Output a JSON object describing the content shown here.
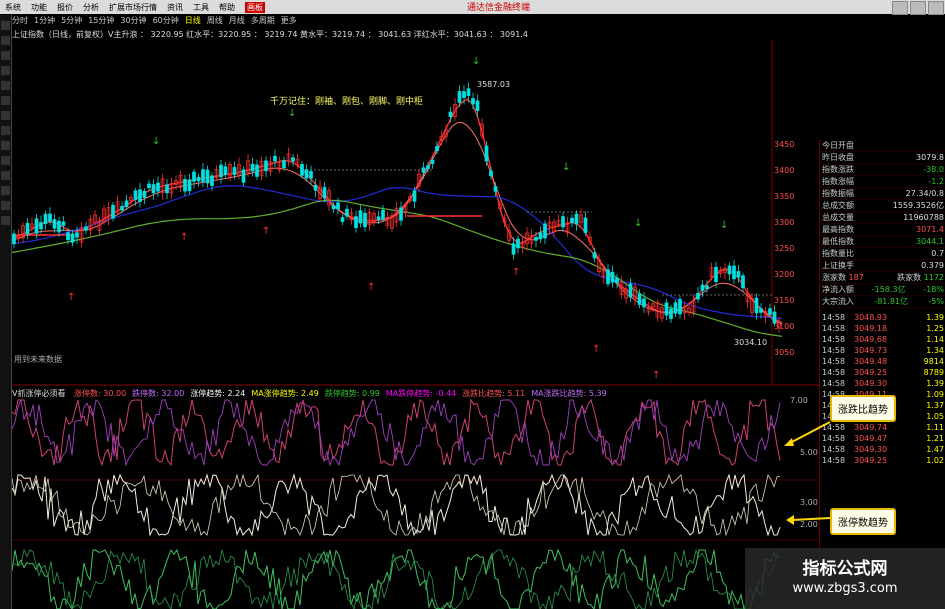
{
  "menubar": {
    "items": [
      "系统",
      "功能",
      "报价",
      "分析",
      "扩展市场行情",
      "资讯",
      "工具",
      "帮助"
    ],
    "active_item": "画板",
    "brand": "通达信金融终端"
  },
  "periods": {
    "items": [
      "分时",
      "1分钟",
      "5分钟",
      "15分钟",
      "30分钟",
      "60分钟",
      "日线",
      "周线",
      "月线",
      "多周期",
      "更多"
    ],
    "active": "日线"
  },
  "info_line": "上证指数（日线，前复权）V主升浪 ： 3220.95 红水平：3220.95 ： 3219.74 黄水平：3219.74 ： 3041.63 洋红水平：3041.63 ： 3091.4",
  "main_chart": {
    "annotation": "千万记住：刚袖、刚包、刚脚、刚中柜",
    "high_label": "3587.03",
    "low_label": "3034.10",
    "axis_ticks": [
      "3450",
      "3400",
      "3350",
      "3300",
      "3250",
      "3200",
      "3150",
      "3100",
      "3050"
    ],
    "past_label": "用到未来数据"
  },
  "indicator1": {
    "title": "V抓涨停必须看",
    "items": [
      {
        "label": "涨停数:",
        "value": "30.00",
        "color": "#ff5050"
      },
      {
        "label": "跌停数:",
        "value": "32.00",
        "color": "#c06cff"
      },
      {
        "label": "涨停趋势:",
        "value": "2.24",
        "color": "#ffffff"
      },
      {
        "label": "MA涨停趋势:",
        "value": "2.49",
        "color": "#ffff00"
      },
      {
        "label": "跌停趋势:",
        "value": "0.99",
        "color": "#2ec72e"
      },
      {
        "label": "MA跌停趋势:",
        "value": "-0.44",
        "color": "#ff00ff"
      },
      {
        "label": "涨跌比趋势:",
        "value": "5.11",
        "color": "#ff5050"
      },
      {
        "label": "MA涨跌比趋势:",
        "value": "5.39",
        "color": "#c06cff"
      }
    ],
    "axis_ticks": [
      "7.00",
      "5.00"
    ]
  },
  "indicator2": {
    "axis_ticks": [
      "3.00",
      "2.00"
    ]
  },
  "right_panel": {
    "rows": [
      {
        "label": "今日开盘",
        "value": "",
        "cls": "pval"
      },
      {
        "label": "昨日收盘",
        "value": "3079.8",
        "cls": "pval"
      },
      {
        "label": "指数涨跌",
        "value": "-38.0",
        "cls": "neg"
      },
      {
        "label": "指数涨幅",
        "value": "-1.2",
        "cls": "neg"
      },
      {
        "label": "指数振幅",
        "value": "27.34/0.8",
        "cls": "pval"
      },
      {
        "label": "总成交额",
        "value": "1559.3526亿",
        "cls": "pval"
      },
      {
        "label": "总成交量",
        "value": "11960788",
        "cls": "pval"
      },
      {
        "label": "最高指数",
        "value": "3071.4",
        "cls": "pos"
      },
      {
        "label": "最低指数",
        "value": "3044.1",
        "cls": "neg"
      },
      {
        "label": "指数量比",
        "value": "0.7",
        "cls": "pval"
      },
      {
        "label": "上证换手",
        "value": "0.379",
        "cls": "pval"
      }
    ],
    "updown": {
      "up_label": "涨家数",
      "up_value": "187",
      "down_label": "跌家数",
      "down_value": "1172"
    },
    "flows": [
      {
        "label": "净流入额",
        "value": "-158.3亿",
        "extra": "-18%"
      },
      {
        "label": "大宗流入",
        "value": "-81.81亿",
        "extra": "-5%"
      }
    ],
    "ticks": [
      {
        "t": "14:58",
        "p": "3048.93",
        "v": "1.39"
      },
      {
        "t": "14:58",
        "p": "3049.18",
        "v": "1.25"
      },
      {
        "t": "14:58",
        "p": "3049.68",
        "v": "1.14"
      },
      {
        "t": "14:58",
        "p": "3049.73",
        "v": "1.34"
      },
      {
        "t": "14:58",
        "p": "3049.48",
        "v": "9814"
      },
      {
        "t": "14:58",
        "p": "3049.25",
        "v": "8789"
      },
      {
        "t": "14:58",
        "p": "3049.30",
        "v": "1.39"
      },
      {
        "t": "14:58",
        "p": "3049.11",
        "v": "1.09"
      },
      {
        "t": "14:58",
        "p": "3049.40",
        "v": "1.37"
      },
      {
        "t": "14:58",
        "p": "3049.56",
        "v": "1.05"
      },
      {
        "t": "14:58",
        "p": "3049.74",
        "v": "1.11"
      },
      {
        "t": "14:58",
        "p": "3049.47",
        "v": "1.21"
      },
      {
        "t": "14:58",
        "p": "3049.30",
        "v": "1.47"
      },
      {
        "t": "14:58",
        "p": "3049.25",
        "v": "1.02"
      }
    ]
  },
  "callouts": {
    "c1": "涨跌比趋势",
    "c2": "涨停数趋势"
  },
  "watermark": {
    "line1": "指标公式网",
    "line2": "www.zbgs3.com"
  },
  "colors": {
    "up": "#ff3030",
    "down": "#00e0e0",
    "ma1": "#ff3030",
    "ma2": "#1e2dd6",
    "ma3": "#5faf2a",
    "ind1a": "#d04070",
    "ind1b": "#a040c0",
    "ind2": "#f0f0e0",
    "ind3": "#40c060"
  }
}
